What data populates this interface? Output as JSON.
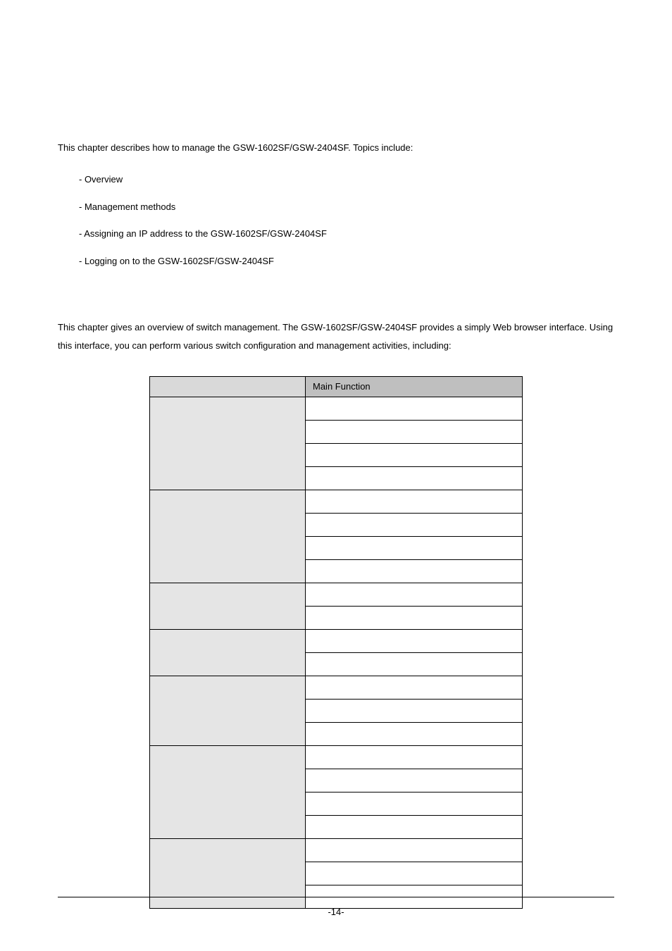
{
  "intro": "This chapter describes how to manage the GSW-1602SF/GSW-2404SF. Topics include:",
  "bullets": {
    "b0": "- Overview",
    "b1": "- Management methods",
    "b2": "- Assigning an IP address to the GSW-1602SF/GSW-2404SF",
    "b3": "- Logging on to the GSW-1602SF/GSW-2404SF"
  },
  "overview_para": "This chapter gives an overview of switch management. The GSW-1602SF/GSW-2404SF provides a simply Web browser interface. Using this interface, you can perform various switch configuration and management activities, including:",
  "table": {
    "header_left": "",
    "header_right": "Main Function",
    "groups": [
      {
        "category": "",
        "rows": [
          "",
          "",
          "",
          ""
        ]
      },
      {
        "category": "",
        "rows": [
          "",
          "",
          "",
          ""
        ]
      },
      {
        "category": "",
        "rows": [
          "",
          ""
        ]
      },
      {
        "category": "",
        "rows": [
          "",
          ""
        ]
      },
      {
        "category": "",
        "rows": [
          "",
          "",
          ""
        ]
      },
      {
        "category": "",
        "rows": [
          "",
          "",
          "",
          ""
        ]
      },
      {
        "category": "",
        "rows": [
          "",
          "",
          ""
        ]
      }
    ]
  },
  "page_number": "-14-"
}
